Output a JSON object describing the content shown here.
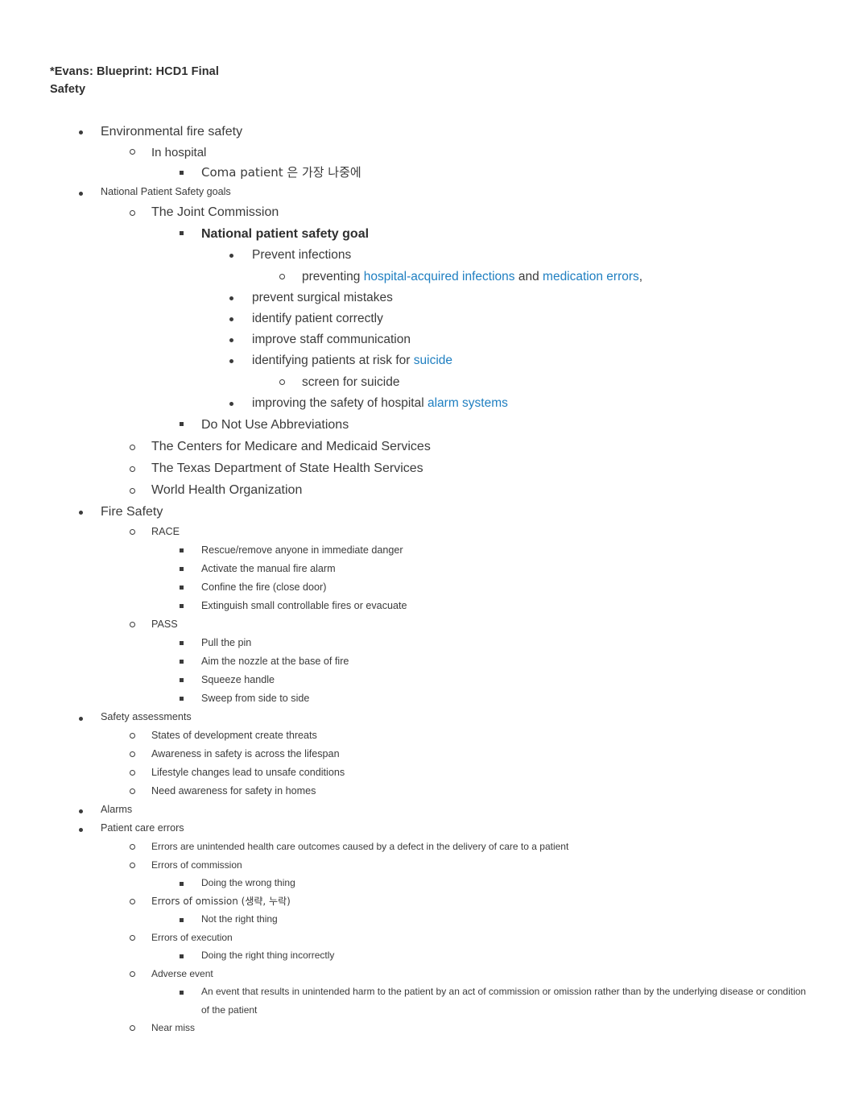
{
  "document": {
    "header": {
      "line1": "*Evans: Blueprint: HCD1 Final",
      "line2": "Safety"
    },
    "link_color": "#1f7fc1",
    "text_color": "#3b3b3b"
  },
  "outline": {
    "environmental_fire_safety": "Environmental fire safety",
    "in_hospital": "In hospital",
    "coma_patient": "Coma patient 은 가장 나중에",
    "national_patient_safety_goals": "National Patient Safety goals",
    "the_joint_commission": "The Joint Commission",
    "national_patient_safety_goal": "National patient safety goal",
    "prevent_infections": "Prevent infections",
    "preventing_prefix": "preventing ",
    "link_hospital_acquired_infections": "hospital-acquired infections",
    "preventing_middle": " and ",
    "link_medication_errors": "medication errors",
    "preventing_suffix": ",",
    "prevent_surgical_mistakes": "prevent surgical mistakes",
    "identify_patient_correctly": "identify patient correctly",
    "improve_staff_communication": "improve staff communication",
    "identifying_patients_prefix": "identifying patients at risk for ",
    "link_suicide": "suicide",
    "screen_for_suicide": "screen for suicide",
    "improving_safety_prefix": "improving the safety of hospital ",
    "link_alarm_systems": "alarm systems",
    "do_not_use_abbreviations": "Do Not Use Abbreviations",
    "cms": "The Centers for Medicare and Medicaid Services",
    "tdshs": "The Texas Department of State Health Services",
    "who": "World Health Organization",
    "fire_safety": "Fire Safety",
    "race": "RACE",
    "race_r": "Rescue/remove anyone in immediate danger",
    "race_a": "Activate the manual fire alarm",
    "race_c": "Confine the fire (close door)",
    "race_e": "Extinguish small controllable fires or evacuate",
    "pass": "PASS",
    "pass_p": "Pull the pin",
    "pass_a": "Aim the nozzle at the base of fire",
    "pass_s": "Squeeze handle",
    "pass_s2": "Sweep from side to side",
    "safety_assessments": "Safety assessments",
    "sa_1": "States of development create threats",
    "sa_2": "Awareness in safety is across the lifespan",
    "sa_3": "Lifestyle changes lead to unsafe conditions",
    "sa_4": "Need awareness for safety in homes",
    "alarms": "Alarms",
    "patient_care_errors": "Patient care errors",
    "pce_def": "Errors are unintended health care outcomes caused by a defect in the delivery of care to a patient",
    "errors_of_commission": "Errors of commission",
    "doing_the_wrong_thing": "Doing the wrong thing",
    "errors_of_omission": "Errors of omission (생략, 누락)",
    "not_the_right_thing": "Not the right thing",
    "errors_of_execution": "Errors of execution",
    "doing_right_thing_incorrectly": "Doing the right thing incorrectly",
    "adverse_event": "Adverse event",
    "adverse_event_def": "An event that results in unintended harm to the patient by an act of commission or omission rather than by the underlying disease or condition of the patient",
    "near_miss": "Near miss"
  }
}
